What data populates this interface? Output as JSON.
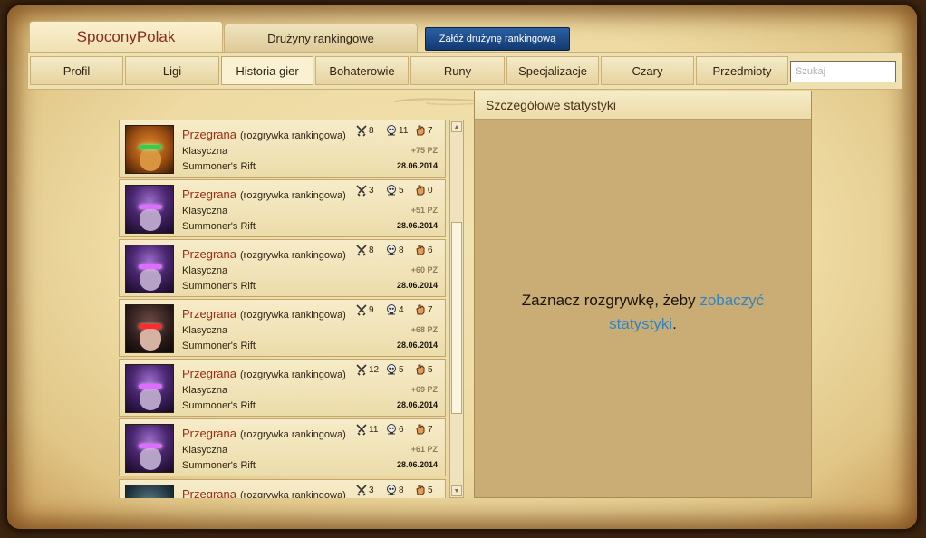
{
  "header": {
    "summoner_name": "SpoconyPolak",
    "ranked_teams_tab": "Drużyny rankingowe",
    "create_team_button": "Załóż drużynę rankingową"
  },
  "nav": {
    "tabs": [
      "Profil",
      "Ligi",
      "Historia gier",
      "Bohaterowie",
      "Runy",
      "Specjalizacje",
      "Czary",
      "Przedmioty"
    ],
    "active_tab": "Historia gier",
    "search_placeholder": "Szukaj"
  },
  "games": [
    {
      "result": "Przegrana",
      "mode": "(rozgrywka rankingowa)",
      "queue": "Klasyczna",
      "map": "Summoner's Rift",
      "kills": "8",
      "deaths": "11",
      "assists": "7",
      "points": "+75 PZ",
      "date": "28.06.2014",
      "portrait": "orange-yordle-icon"
    },
    {
      "result": "Przegrana",
      "mode": "(rozgrywka rankingowa)",
      "queue": "Klasyczna",
      "map": "Summoner's Rift",
      "kills": "3",
      "deaths": "5",
      "assists": "0",
      "points": "+51 PZ",
      "date": "28.06.2014",
      "portrait": "purple-masked-champion-icon"
    },
    {
      "result": "Przegrana",
      "mode": "(rozgrywka rankingowa)",
      "queue": "Klasyczna",
      "map": "Summoner's Rift",
      "kills": "8",
      "deaths": "8",
      "assists": "6",
      "points": "+60 PZ",
      "date": "28.06.2014",
      "portrait": "purple-masked-champion-icon"
    },
    {
      "result": "Przegrana",
      "mode": "(rozgrywka rankingowa)",
      "queue": "Klasyczna",
      "map": "Summoner's Rift",
      "kills": "9",
      "deaths": "4",
      "assists": "7",
      "points": "+68 PZ",
      "date": "28.06.2014",
      "portrait": "red-goggles-champion-icon"
    },
    {
      "result": "Przegrana",
      "mode": "(rozgrywka rankingowa)",
      "queue": "Klasyczna",
      "map": "Summoner's Rift",
      "kills": "12",
      "deaths": "5",
      "assists": "5",
      "points": "+69 PZ",
      "date": "28.06.2014",
      "portrait": "purple-masked-champion-icon"
    },
    {
      "result": "Przegrana",
      "mode": "(rozgrywka rankingowa)",
      "queue": "Klasyczna",
      "map": "Summoner's Rift",
      "kills": "11",
      "deaths": "6",
      "assists": "7",
      "points": "+61 PZ",
      "date": "28.06.2014",
      "portrait": "purple-masked-champion-icon"
    },
    {
      "result": "Przegrana",
      "mode": "(rozgrywka rankingowa)",
      "queue": "",
      "map": "",
      "kills": "3",
      "deaths": "8",
      "assists": "5",
      "points": "",
      "date": "",
      "portrait": "dark-teal-champion-icon"
    }
  ],
  "detail": {
    "header": "Szczegółowe statystyki",
    "message_part1": "Zaznacz rozgrywkę, żeby ",
    "message_link": "zobaczyć statystyki",
    "message_end": "."
  },
  "colors": {
    "result_loss": "#9c2a14",
    "link": "#2f84c9",
    "create_button": "#1f4f8f"
  }
}
